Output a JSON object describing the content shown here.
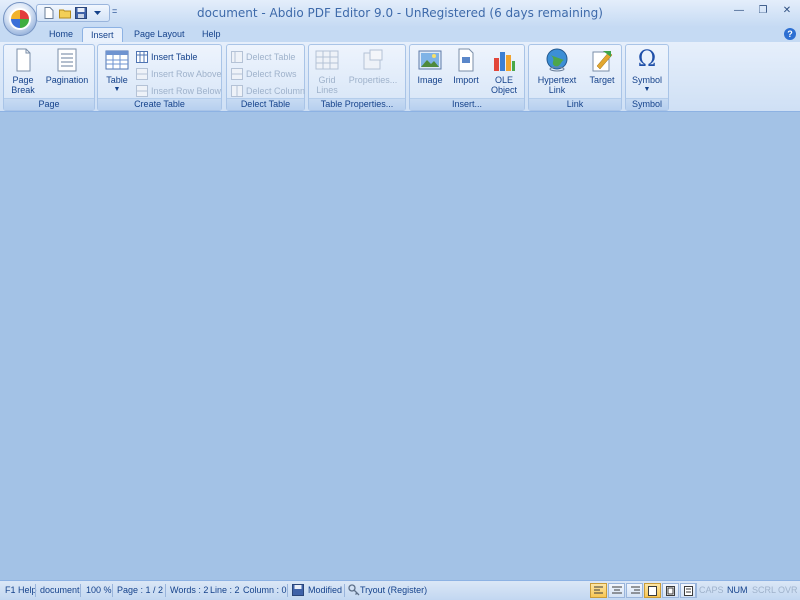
{
  "window": {
    "title": "document - Abdio PDF Editor 9.0 - UnRegistered (6 days remaining)",
    "controls": [
      "minimize",
      "restore",
      "close"
    ]
  },
  "qat": {
    "icons": [
      "new-document-icon",
      "open-folder-icon",
      "save-icon"
    ],
    "more_label": "="
  },
  "tabs": [
    {
      "label": "Home",
      "active": false
    },
    {
      "label": "Insert",
      "active": true
    },
    {
      "label": "Page Layout",
      "active": false
    },
    {
      "label": "Help",
      "active": false
    }
  ],
  "ribbon": {
    "page": {
      "label": "Page",
      "page_break": "Page Break",
      "pagination": "Pagination"
    },
    "create_table": {
      "label": "Create Table",
      "table": "Table",
      "insert_table": "Insert Table",
      "insert_row_above": "Insert Row Above",
      "insert_row_below": "Insert Row Below"
    },
    "delect_table": {
      "label": "Delect Table",
      "delect_table": "Delect Table",
      "delect_rows": "Delect Rows",
      "delect_column": "Delect Column"
    },
    "table_properties": {
      "label": "Table Properties...",
      "grid_lines": "Grid Lines",
      "properties": "Properties..."
    },
    "insert": {
      "label": "Insert...",
      "image": "Image",
      "import": "Import",
      "ole_object": "OLE Object"
    },
    "link": {
      "label": "Link",
      "hypertext_link": "Hypertext Link",
      "target": "Target"
    },
    "symbol": {
      "label": "Symbol",
      "symbol": "Symbol",
      "glyph": "Ω"
    }
  },
  "statusbar": {
    "help": "F1 Help",
    "doc": "document",
    "zoom": "100 %",
    "page": "Page : 1 / 2",
    "words": "Words : 2",
    "line": "Line : 2",
    "column": "Column : 0",
    "modified": "Modified",
    "tryout": "Tryout (Register)",
    "caps": "CAPS",
    "num": "NUM",
    "scrl": "SCRL",
    "ovr": "OVR"
  },
  "colors": {
    "workspace": "#a3c2e6",
    "ribbon_text": "#15428b",
    "disabled_text": "#9fb2cb",
    "active_view": "#f8c653"
  }
}
